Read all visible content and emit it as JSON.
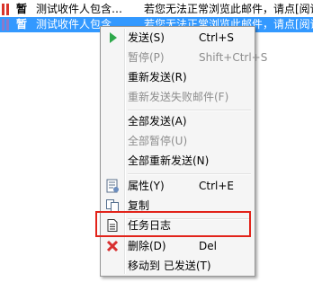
{
  "mail_list": {
    "rows": [
      {
        "status": "暂",
        "subject": "测试收件人包含…",
        "preview": "若您无法正常浏览此邮件，请点[阅读"
      },
      {
        "status": "暂",
        "subject": "测试收件人包含",
        "preview": "若您无法正常浏览此邮件，请点[阅读"
      }
    ]
  },
  "context_menu": {
    "items": {
      "send": {
        "label": "发送(S)",
        "shortcut": "Ctrl+S",
        "icon": "play-arrow-icon"
      },
      "pause": {
        "label": "暂停(P)",
        "shortcut": "Shift+Ctrl+S",
        "disabled": true
      },
      "resend": {
        "label": "重新发送(R)"
      },
      "resend_failed": {
        "label": "重新发送失败邮件(F)",
        "disabled": true
      },
      "send_all": {
        "label": "全部发送(A)"
      },
      "pause_all": {
        "label": "全部暂停(U)",
        "disabled": true
      },
      "resend_all": {
        "label": "全部重新发送(N)"
      },
      "properties": {
        "label": "属性(Y)",
        "shortcut": "Ctrl+E",
        "icon": "properties-icon"
      },
      "copy": {
        "label": "复制",
        "icon": "copy-icon"
      },
      "task_log": {
        "label": "任务日志",
        "icon": "document-icon"
      },
      "delete": {
        "label": "删除(D)",
        "shortcut": "Del",
        "icon": "delete-x-icon"
      },
      "move_to_sent": {
        "label": "移动到 已发送(T)"
      }
    },
    "highlighted_item": "task_log",
    "highlight_color": "#e2231a"
  },
  "colors": {
    "selection": "#3399ff",
    "send_icon": "#2da84a",
    "delete_icon": "#d83030"
  }
}
